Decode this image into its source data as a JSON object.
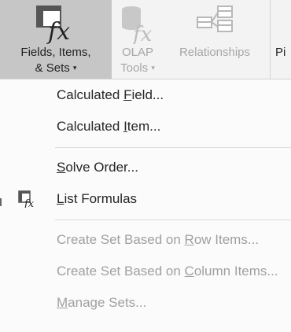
{
  "ribbon": {
    "fields_items_sets": {
      "line1": "Fields, Items,",
      "line2": "& Sets",
      "caret": "▾",
      "icon": "calculated-field-fx-icon"
    },
    "olap_tools": {
      "line1": "OLAP",
      "line2": "Tools",
      "caret": "▾",
      "icon": "cube-fx-icon"
    },
    "relationships": {
      "label": "Relationships",
      "icon": "relationships-icon"
    },
    "next_partial": {
      "label": "Pi"
    }
  },
  "menu": {
    "calculated_field": {
      "before": "Calculated ",
      "accel": "F",
      "after": "ield..."
    },
    "calculated_item": {
      "before": "Calculated ",
      "accel": "I",
      "after": "tem..."
    },
    "solve_order": {
      "before": "",
      "accel": "S",
      "after": "olve Order..."
    },
    "list_formulas": {
      "before": "",
      "accel": "L",
      "after": "ist Formulas",
      "icon": "list-formulas-icon"
    },
    "create_set_rows": {
      "before": "Create Set Based on ",
      "accel": "R",
      "after": "ow Items..."
    },
    "create_set_columns": {
      "before": "Create Set Based on ",
      "accel": "C",
      "after": "olumn Items..."
    },
    "manage_sets": {
      "before": "",
      "accel": "M",
      "after": "anage Sets..."
    }
  },
  "colors": {
    "selected_button_bg": "#c6c6c6",
    "disabled_text": "#a0a0a0",
    "menu_bg": "#fbfbfb"
  }
}
